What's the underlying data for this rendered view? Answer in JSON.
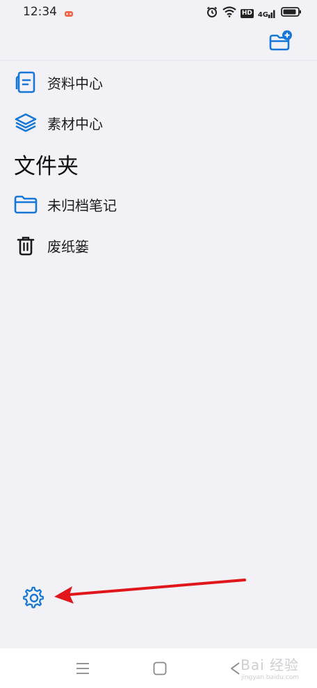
{
  "status_bar": {
    "time": "12:34",
    "hd_badge": "HD",
    "network": "4G",
    "icons": [
      "game-icon",
      "alarm-icon",
      "wifi-icon",
      "hd-icon",
      "signal-icon",
      "battery-icon"
    ]
  },
  "toolbar": {
    "new_folder_icon": "folder-plus-icon"
  },
  "menu": {
    "items": [
      {
        "label": "资料中心",
        "icon": "document-icon"
      },
      {
        "label": "素材中心",
        "icon": "layers-icon"
      }
    ]
  },
  "folders": {
    "title": "文件夹",
    "items": [
      {
        "label": "未归档笔记",
        "icon": "folder-icon"
      },
      {
        "label": "废纸篓",
        "icon": "trash-icon"
      }
    ]
  },
  "footer": {
    "settings_icon": "gear-icon"
  },
  "nav_bar": {
    "icons": [
      "menu-icon",
      "home-icon",
      "back-icon"
    ]
  },
  "watermark": {
    "text": "Bai 经验",
    "subtext": "jingyan.baidu.com"
  },
  "colors": {
    "accent": "#1677d8",
    "background": "#f1f1f6",
    "annotation": "#e0161b"
  }
}
